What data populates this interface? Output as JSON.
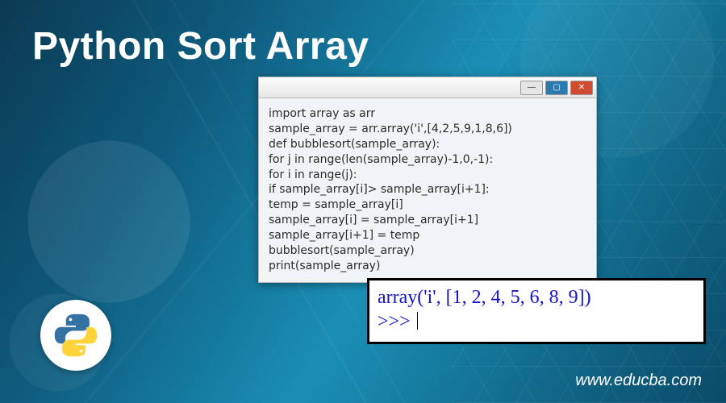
{
  "title": "Python Sort Array",
  "window": {
    "buttons": {
      "min": "—",
      "max": "▢",
      "close": "✕"
    },
    "code": [
      "import array as arr",
      "sample_array = arr.array('i',[4,2,5,9,1,8,6])",
      "def bubblesort(sample_array):",
      "for j in range(len(sample_array)-1,0,-1):",
      "for i in range(j):",
      "if sample_array[i]> sample_array[i+1]:",
      "temp = sample_array[i]",
      "sample_array[i] = sample_array[i+1]",
      "sample_array[i+1] = temp",
      "bubblesort(sample_array)",
      "print(sample_array)"
    ]
  },
  "output": {
    "line1": "array('i', [1, 2, 4, 5, 6, 8, 9])",
    "prompt": ">>> "
  },
  "footer": {
    "url": "www.educba.com"
  },
  "logo": {
    "name": "python-logo",
    "colors": {
      "blue": "#3571a3",
      "yellow": "#ffd43b"
    }
  }
}
